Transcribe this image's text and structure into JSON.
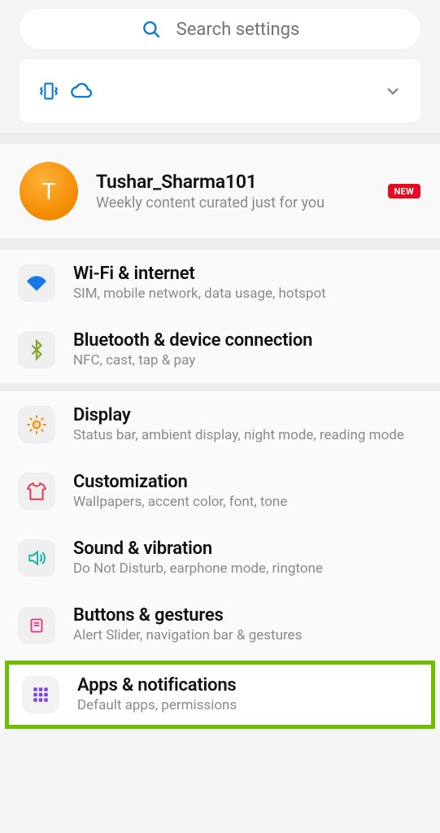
{
  "search": {
    "placeholder": "Search settings"
  },
  "profile": {
    "initial": "T",
    "name": "Tushar_Sharma101",
    "subtitle": "Weekly content curated just for you",
    "badge": "NEW"
  },
  "rows": {
    "wifi": {
      "title": "Wi-Fi & internet",
      "sub": "SIM, mobile network, data usage, hotspot"
    },
    "bt": {
      "title": "Bluetooth & device connection",
      "sub": "NFC, cast, tap & pay"
    },
    "display": {
      "title": "Display",
      "sub": "Status bar, ambient display, night mode, reading mode"
    },
    "custom": {
      "title": "Customization",
      "sub": "Wallpapers, accent color, font, tone"
    },
    "sound": {
      "title": "Sound & vibration",
      "sub": "Do Not Disturb, earphone mode, ringtone"
    },
    "buttons": {
      "title": "Buttons & gestures",
      "sub": "Alert Slider, navigation bar & gestures"
    },
    "apps": {
      "title": "Apps & notifications",
      "sub": "Default apps, permissions"
    }
  },
  "colors": {
    "accent_blue": "#0a7cd6",
    "accent_teal": "#15b5a6",
    "accent_orange": "#f38c00",
    "accent_red": "#ea3447",
    "accent_purple": "#7b3fe4",
    "accent_olive": "#86a427",
    "badge_red": "#e40b22",
    "highlight": "#6fbf00"
  }
}
